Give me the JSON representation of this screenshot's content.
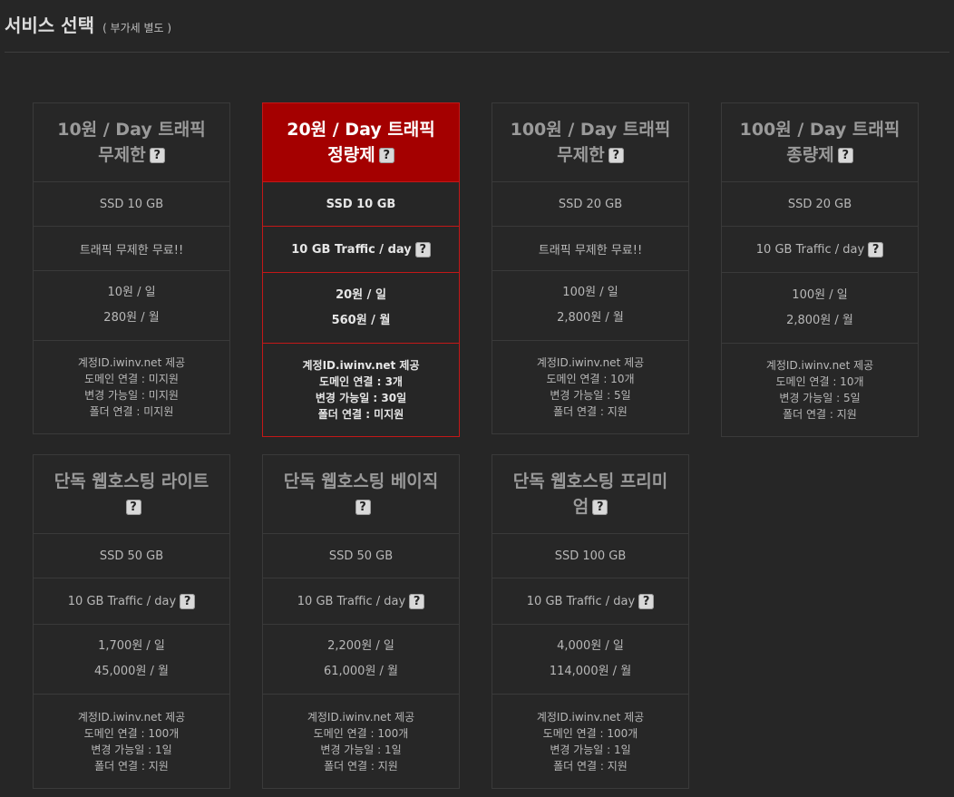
{
  "header": {
    "title": "서비스 선택",
    "subtitle": "( 부가세 별도 )"
  },
  "plans": [
    {
      "name": "10원 / Day 트래픽 무제한",
      "storage": "SSD 10 GB",
      "traffic": "트래픽 무제한 무료!!",
      "traffic_help": false,
      "price_day": "10원 / 일",
      "price_month": "280원 / 월",
      "info": [
        "계정ID.iwinv.net 제공",
        "도메인 연결 : 미지원",
        "변경 가능일 : 미지원",
        "폴더 연결 : 미지원"
      ]
    },
    {
      "name": "20원 / Day 트래픽 정량제",
      "storage": "SSD 10 GB",
      "traffic": "10 GB Traffic / day",
      "traffic_help": true,
      "price_day": "20원 / 일",
      "price_month": "560원 / 월",
      "selected": true,
      "info": [
        "계정ID.iwinv.net 제공",
        "도메인 연결 : 3개",
        "변경 가능일 : 30일",
        "폴더 연결 : 미지원"
      ]
    },
    {
      "name": "100원 / Day 트래픽 무제한",
      "storage": "SSD 20 GB",
      "traffic": "트래픽 무제한 무료!!",
      "traffic_help": false,
      "price_day": "100원 / 일",
      "price_month": "2,800원 / 월",
      "info": [
        "계정ID.iwinv.net 제공",
        "도메인 연결 : 10개",
        "변경 가능일 : 5일",
        "폴더 연결 : 지원"
      ]
    },
    {
      "name": "100원 / Day 트래픽 종량제",
      "storage": "SSD 20 GB",
      "traffic": "10 GB Traffic / day",
      "traffic_help": true,
      "price_day": "100원 / 일",
      "price_month": "2,800원 / 월",
      "info": [
        "계정ID.iwinv.net 제공",
        "도메인 연결 : 10개",
        "변경 가능일 : 5일",
        "폴더 연결 : 지원"
      ]
    },
    {
      "name": "단독 웹호스팅 라이트",
      "storage": "SSD 50 GB",
      "traffic": "10 GB Traffic / day",
      "traffic_help": true,
      "price_day": "1,700원 / 일",
      "price_month": "45,000원 / 월",
      "info": [
        "계정ID.iwinv.net 제공",
        "도메인 연결 : 100개",
        "변경 가능일 : 1일",
        "폴더 연결 : 지원"
      ]
    },
    {
      "name": "단독 웹호스팅 베이직",
      "storage": "SSD 50 GB",
      "traffic": "10 GB Traffic / day",
      "traffic_help": true,
      "price_day": "2,200원 / 일",
      "price_month": "61,000원 / 월",
      "info": [
        "계정ID.iwinv.net 제공",
        "도메인 연결 : 100개",
        "변경 가능일 : 1일",
        "폴더 연결 : 지원"
      ]
    },
    {
      "name": "단독 웹호스팅 프리미엄",
      "storage": "SSD 100 GB",
      "traffic": "10 GB Traffic / day",
      "traffic_help": true,
      "price_day": "4,000원 / 일",
      "price_month": "114,000원 / 월",
      "info": [
        "계정ID.iwinv.net 제공",
        "도메인 연결 : 100개",
        "변경 가능일 : 1일",
        "폴더 연결 : 지원"
      ]
    }
  ],
  "help_glyph": "?",
  "colors": {
    "background": "#262626",
    "selected_header": "#a40000",
    "selected_border": "#c31818",
    "card_border": "#3a3a3a"
  }
}
